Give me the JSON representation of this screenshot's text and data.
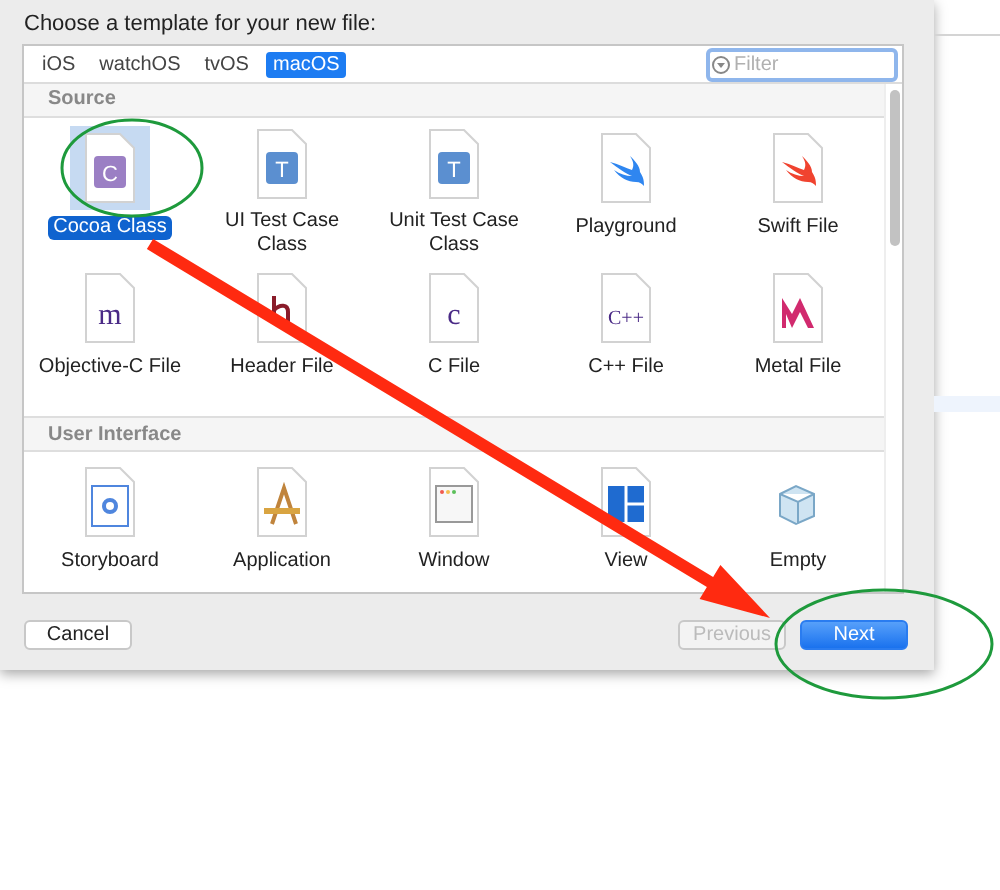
{
  "dialog": {
    "title": "Choose a template for your new file:",
    "tabs": [
      {
        "label": "iOS",
        "selected": false
      },
      {
        "label": "watchOS",
        "selected": false
      },
      {
        "label": "tvOS",
        "selected": false
      },
      {
        "label": "macOS",
        "selected": true
      }
    ],
    "filter": {
      "placeholder": "Filter"
    },
    "sections": [
      {
        "title": "Source",
        "items": [
          {
            "label": "Cocoa Class",
            "kind": "letter",
            "glyph": "C",
            "selected": true
          },
          {
            "label": "UI Test Case Class",
            "kind": "letter",
            "glyph": "T",
            "selected": false
          },
          {
            "label": "Unit Test Case Class",
            "kind": "letter",
            "glyph": "T",
            "selected": false
          },
          {
            "label": "Playground",
            "kind": "playground",
            "selected": false
          },
          {
            "label": "Swift File",
            "kind": "swift",
            "selected": false
          },
          {
            "label": "Objective-C File",
            "kind": "serif",
            "glyph": "m",
            "selected": false
          },
          {
            "label": "Header File",
            "kind": "header",
            "selected": false
          },
          {
            "label": "C File",
            "kind": "serif",
            "glyph": "c",
            "selected": false
          },
          {
            "label": "C++ File",
            "kind": "serif",
            "glyph": "C++",
            "selected": false
          },
          {
            "label": "Metal File",
            "kind": "metal",
            "selected": false
          }
        ]
      },
      {
        "title": "User Interface",
        "items": [
          {
            "label": "Storyboard",
            "kind": "storyboard",
            "selected": false
          },
          {
            "label": "Application",
            "kind": "application",
            "selected": false
          },
          {
            "label": "Window",
            "kind": "window",
            "selected": false
          },
          {
            "label": "View",
            "kind": "view",
            "selected": false
          },
          {
            "label": "Empty",
            "kind": "empty",
            "selected": false
          }
        ]
      }
    ],
    "buttons": [
      {
        "label": "Cancel",
        "kind": "normal"
      },
      {
        "label": "Previous",
        "kind": "disabled"
      },
      {
        "label": "Next",
        "kind": "default"
      }
    ]
  }
}
